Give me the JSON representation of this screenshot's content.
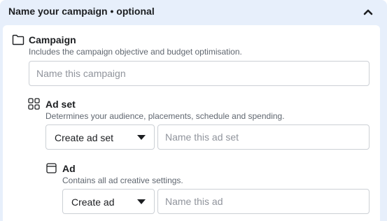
{
  "header": {
    "title": "Name your campaign • optional",
    "collapse_icon": "chevron-up-icon"
  },
  "campaign": {
    "icon": "folder-icon",
    "title": "Campaign",
    "description": "Includes the campaign objective and budget optimisation.",
    "name_placeholder": "Name this campaign",
    "name_value": ""
  },
  "ad_set": {
    "icon": "grid-icon",
    "title": "Ad set",
    "description": "Determines your audience, placements, schedule and spending.",
    "select_value": "Create ad set",
    "name_placeholder": "Name this ad set",
    "name_value": ""
  },
  "ad": {
    "icon": "ad-window-icon",
    "title": "Ad",
    "description": "Contains all ad creative settings.",
    "select_value": "Create ad",
    "name_placeholder": "Name this ad",
    "name_value": ""
  },
  "colors": {
    "panel_background": "#e7effb",
    "text_primary": "#1c1e21",
    "text_secondary": "#606770",
    "border": "#ccd0d5",
    "placeholder": "#90949c"
  }
}
